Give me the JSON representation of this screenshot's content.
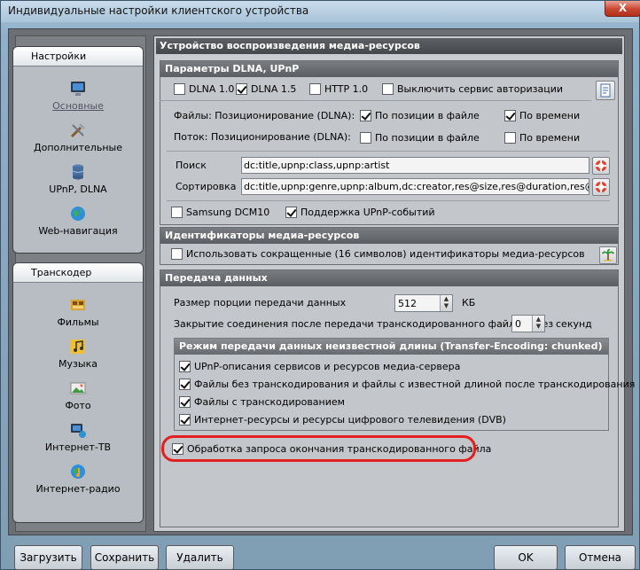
{
  "window": {
    "title": "Индивидуальные настройки клиентского устройства",
    "close": "X"
  },
  "nav": {
    "group1": {
      "header": "Настройки",
      "items": [
        {
          "label": "Основные",
          "icon": "monitor-icon"
        },
        {
          "label": "Дополнительные",
          "icon": "tools-icon"
        },
        {
          "label": "UPnP, DLNA",
          "icon": "database-icon"
        },
        {
          "label": "Web-навигация",
          "icon": "globe-icon"
        }
      ]
    },
    "group2": {
      "header": "Транскодер",
      "items": [
        {
          "label": "Фильмы",
          "icon": "film-icon"
        },
        {
          "label": "Музыка",
          "icon": "music-icon"
        },
        {
          "label": "Фото",
          "icon": "photo-icon"
        },
        {
          "label": "Интернет-ТВ",
          "icon": "internet-tv-icon"
        },
        {
          "label": "Интернет-радио",
          "icon": "internet-radio-icon"
        }
      ]
    }
  },
  "main": {
    "title": "Устройство воспроизведения медиа-ресурсов",
    "dlna": {
      "header": "Параметры DLNA, UPnP",
      "dlna10": {
        "label": "DLNA 1.0",
        "checked": false
      },
      "dlna15": {
        "label": "DLNA 1.5",
        "checked": true
      },
      "http10": {
        "label": "HTTP 1.0",
        "checked": false
      },
      "disable_auth": {
        "label": "Выключить сервис авторизации",
        "checked": false
      },
      "files_label": "Файлы: Позиционирование (DLNA):",
      "stream_label": "Поток: Позиционирование (DLNA):",
      "by_position": "По позиции в файле",
      "by_time": "По времени",
      "search_label": "Поиск",
      "search_value": "dc:title,upnp:class,upnp:artist",
      "sort_label": "Сортировка",
      "sort_value": "dc:title,upnp:genre,upnp:album,dc:creator,res@size,res@duration,res@bitrate,d",
      "samsung": {
        "label": "Samsung DCM10",
        "checked": false
      },
      "upnp_events": {
        "label": "Поддержка UPnP-событий",
        "checked": true
      }
    },
    "ids": {
      "header": "Идентификаторы медиа-ресурсов",
      "short_ids": {
        "label": "Использовать сокращенные (16 символов) идентификаторы медиа-ресурсов",
        "checked": false
      }
    },
    "transfer": {
      "header": "Передача данных",
      "chunk_label": "Размер порции передачи данных",
      "chunk_value": "512",
      "chunk_unit": "КБ",
      "close_label": "Закрытие соединения после передачи транскодированного файла через",
      "close_value": "0",
      "close_unit": "секунд",
      "sub_header": "Режим передачи данных неизвестной длины (Transfer-Encoding: chunked)",
      "opts": [
        "UPnP-описания сервисов и ресурсов медиа-сервера",
        "Файлы без транскодирования и файлы с известной длиной после транскодирования",
        "Файлы с транскодированием",
        "Интернет-ресурсы и ресурсы цифрового телевидения (DVB)"
      ],
      "end_request": {
        "label": "Обработка запроса окончания транскодированного файла",
        "checked": true
      }
    }
  },
  "buttons": {
    "load": "Загрузить",
    "save": "Сохранить",
    "delete": "Удалить",
    "ok": "OK",
    "cancel": "Отмена"
  }
}
